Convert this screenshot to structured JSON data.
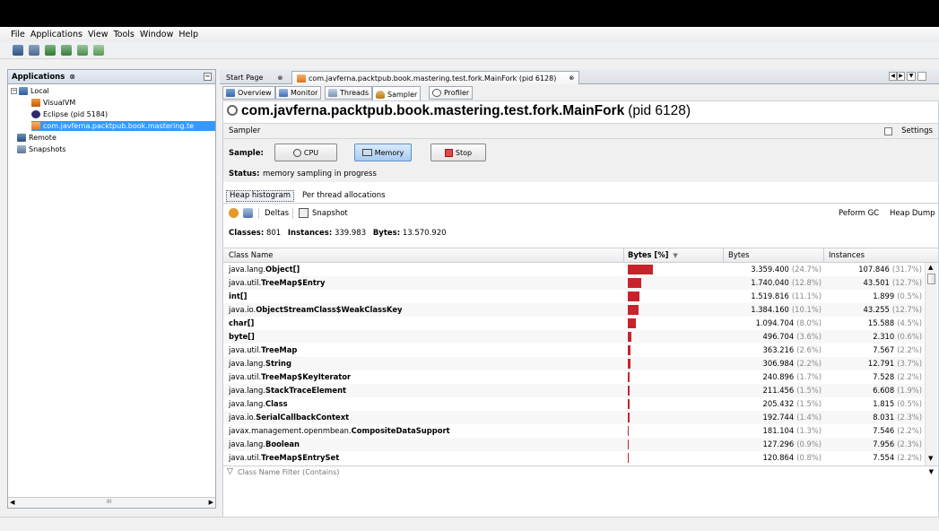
{
  "menu": [
    "File",
    "Applications",
    "View",
    "Tools",
    "Window",
    "Help"
  ],
  "left_panel": {
    "title": "Applications",
    "close_glyph": "⊗",
    "items": [
      {
        "label": "Local",
        "depth": 0,
        "expander": "−"
      },
      {
        "label": "VisualVM",
        "depth": 1
      },
      {
        "label": "Eclipse (pid 5184)",
        "depth": 1
      },
      {
        "label": "com.javferna.packtpub.book.mastering.te",
        "depth": 1,
        "selected": true
      },
      {
        "label": "Remote",
        "depth": 0
      },
      {
        "label": "Snapshots",
        "depth": 0
      }
    ],
    "scroll_glyph": "III"
  },
  "doc_tabs": {
    "start_page": "Start Page",
    "main": "com.javferna.packtpub.book.mastering.test.fork.MainFork (pid 6128)",
    "close_glyph": "⊗"
  },
  "sub_tabs": [
    "Overview",
    "Monitor",
    "Threads",
    "Sampler",
    "Profiler"
  ],
  "app_title": "com.javferna.packtpub.book.mastering.test.fork.MainFork",
  "app_pid": "(pid 6128)",
  "sampler_label": "Sampler",
  "settings_label": "Settings",
  "sample_label": "Sample:",
  "buttons": {
    "cpu": "CPU",
    "memory": "Memory",
    "stop": "Stop"
  },
  "status_label": "Status:",
  "status_text": "memory sampling in progress",
  "inner_tabs": [
    "Heap histogram",
    "Per thread allocations"
  ],
  "toolbar2": {
    "deltas": "Deltas",
    "snapshot": "Snapshot",
    "gc": "Peform GC",
    "heapdump": "Heap Dump"
  },
  "summary": {
    "classes_label": "Classes:",
    "classes": "801",
    "instances_label": "Instances:",
    "instances": "339.983",
    "bytes_label": "Bytes:",
    "bytes": "13.570.920"
  },
  "columns": [
    "Class Name",
    "Bytes [%]",
    "Bytes",
    "Instances"
  ],
  "sort_glyph": "▼",
  "rows": [
    {
      "pkg": "java.lang.",
      "cls": "Object[]",
      "pct": 24.7,
      "bytes": "3.359.400",
      "bpct": "(24.7%)",
      "inst": "107.846",
      "ipct": "(31.7%)"
    },
    {
      "pkg": "java.util.",
      "cls": "TreeMap$Entry",
      "pct": 12.8,
      "bytes": "1.740.040",
      "bpct": "(12.8%)",
      "inst": "43.501",
      "ipct": "(12.7%)"
    },
    {
      "pkg": "",
      "cls": "int[]",
      "pct": 11.1,
      "bytes": "1.519.816",
      "bpct": "(11.1%)",
      "inst": "1.899",
      "ipct": "(0.5%)"
    },
    {
      "pkg": "java.io.",
      "cls": "ObjectStreamClass$WeakClassKey",
      "pct": 10.1,
      "bytes": "1.384.160",
      "bpct": "(10.1%)",
      "inst": "43.255",
      "ipct": "(12.7%)"
    },
    {
      "pkg": "",
      "cls": "char[]",
      "pct": 8.0,
      "bytes": "1.094.704",
      "bpct": "(8.0%)",
      "inst": "15.588",
      "ipct": "(4.5%)"
    },
    {
      "pkg": "",
      "cls": "byte[]",
      "pct": 3.6,
      "bytes": "496.704",
      "bpct": "(3.6%)",
      "inst": "2.310",
      "ipct": "(0.6%)"
    },
    {
      "pkg": "java.util.",
      "cls": "TreeMap",
      "pct": 2.6,
      "bytes": "363.216",
      "bpct": "(2.6%)",
      "inst": "7.567",
      "ipct": "(2.2%)"
    },
    {
      "pkg": "java.lang.",
      "cls": "String",
      "pct": 2.2,
      "bytes": "306.984",
      "bpct": "(2.2%)",
      "inst": "12.791",
      "ipct": "(3.7%)"
    },
    {
      "pkg": "java.util.",
      "cls": "TreeMap$KeyIterator",
      "pct": 1.7,
      "bytes": "240.896",
      "bpct": "(1.7%)",
      "inst": "7.528",
      "ipct": "(2.2%)"
    },
    {
      "pkg": "java.lang.",
      "cls": "StackTraceElement",
      "pct": 1.5,
      "bytes": "211.456",
      "bpct": "(1.5%)",
      "inst": "6.608",
      "ipct": "(1.9%)"
    },
    {
      "pkg": "java.lang.",
      "cls": "Class",
      "pct": 1.5,
      "bytes": "205.432",
      "bpct": "(1.5%)",
      "inst": "1.815",
      "ipct": "(0.5%)"
    },
    {
      "pkg": "java.io.",
      "cls": "SerialCallbackContext",
      "pct": 1.4,
      "bytes": "192.744",
      "bpct": "(1.4%)",
      "inst": "8.031",
      "ipct": "(2.3%)"
    },
    {
      "pkg": "javax.management.openmbean.",
      "cls": "CompositeDataSupport",
      "pct": 1.3,
      "bytes": "181.104",
      "bpct": "(1.3%)",
      "inst": "7.546",
      "ipct": "(2.2%)"
    },
    {
      "pkg": "java.lang.",
      "cls": "Boolean",
      "pct": 0.9,
      "bytes": "127.296",
      "bpct": "(0.9%)",
      "inst": "7.956",
      "ipct": "(2.3%)"
    },
    {
      "pkg": "java.util.",
      "cls": "TreeMap$EntrySet",
      "pct": 0.8,
      "bytes": "120.864",
      "bpct": "(0.8%)",
      "inst": "7.554",
      "ipct": "(2.2%)"
    }
  ],
  "filter_placeholder": "Class Name Filter (Contains)",
  "colors": {
    "bar": "#c8232c",
    "selection": "#3399ff"
  }
}
